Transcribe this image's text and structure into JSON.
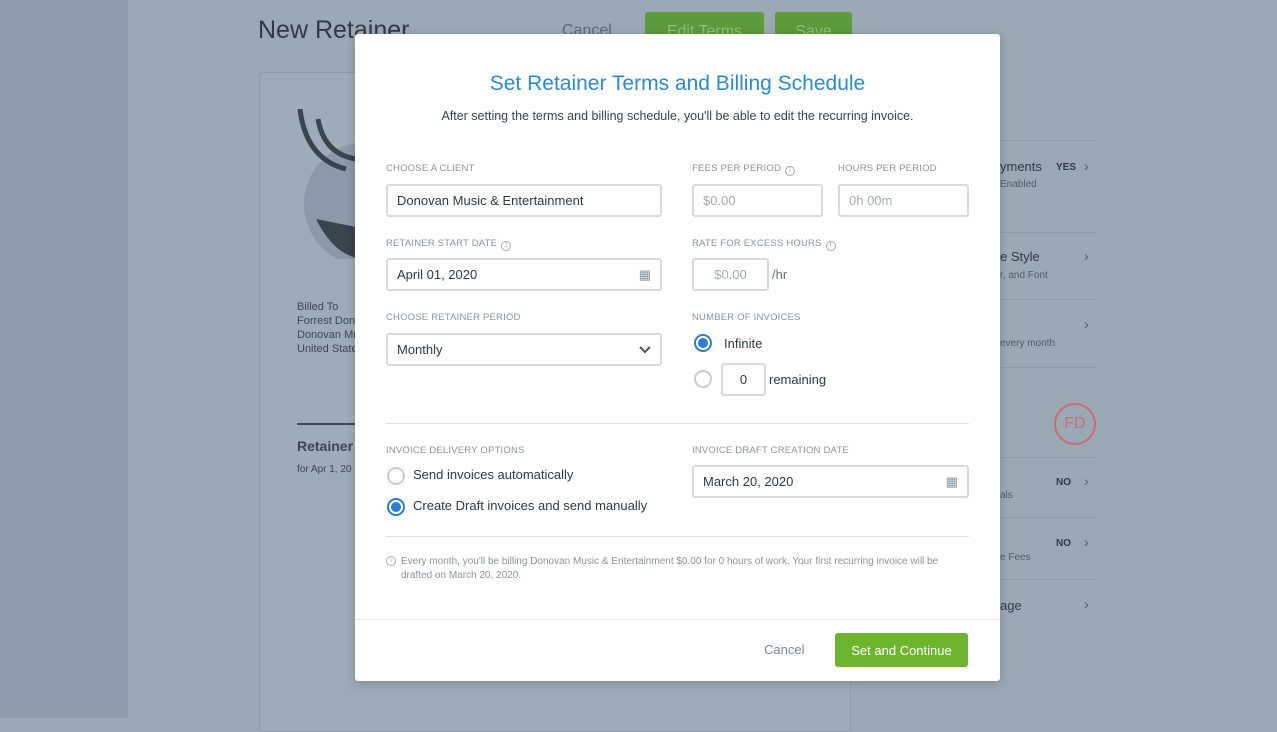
{
  "background": {
    "title": "New Retainer",
    "cancel": "Cancel",
    "edit_terms": "Edit Terms",
    "save": "Save",
    "billed_to": [
      "Billed To",
      "Forrest Don",
      "Donovan Mu",
      "United State"
    ],
    "retainer_title": "Retainer",
    "retainer_sub": "for Apr 1, 20",
    "avatar_initials": "FD",
    "right_panel": [
      {
        "title": "yments",
        "sub": "Enabled",
        "badge": "YES"
      },
      {
        "title": "e Style",
        "sub": "r, and Font",
        "badge": ""
      },
      {
        "title": "",
        "sub": "every month",
        "badge": ""
      },
      {
        "title": "",
        "sub": "als",
        "badge": "NO"
      },
      {
        "title": "",
        "sub": "e Fees",
        "badge": "NO"
      },
      {
        "title": "age",
        "sub": "",
        "badge": ""
      }
    ]
  },
  "modal": {
    "title": "Set Retainer Terms and Billing Schedule",
    "subtitle": "After setting the terms and billing schedule, you'll be able to edit the recurring invoice.",
    "client_label": "Choose a Client",
    "client_value": "Donovan Music & Entertainment",
    "start_label": "Retainer Start Date",
    "start_value": "April 01, 2020",
    "period_label": "Choose Retainer Period",
    "period_value": "Monthly",
    "fees_label": "Fees per Period",
    "fees_placeholder": "$0.00",
    "hours_label": "Hours per Period",
    "hours_placeholder": "0h 00m",
    "excess_label": "Rate for Excess Hours",
    "excess_placeholder": "$0.00",
    "excess_unit": "/hr",
    "invoices_label": "Number of Invoices",
    "infinite_label": "Infinite",
    "remaining_value": "0",
    "remaining_label": "remaining",
    "invoices_selected": "Infinite",
    "delivery_label": "Invoice Delivery Options",
    "delivery_auto": "Send invoices automatically",
    "delivery_manual": "Create Draft invoices and send manually",
    "delivery_selected": "Create Draft invoices and send manually",
    "draft_label": "Invoice Draft Creation Date",
    "draft_value": "March 20, 2020",
    "note": "Every month, you'll be billing Donovan Music & Entertainment $0.00 for 0 hours of work. Your first recurring invoice will be drafted on March 20, 2020.",
    "cancel": "Cancel",
    "submit": "Set and Continue"
  },
  "colors": {
    "accent": "#2b8ad6",
    "primary_button": "#6cb52d",
    "radio_selected": "#2b7fd0"
  }
}
